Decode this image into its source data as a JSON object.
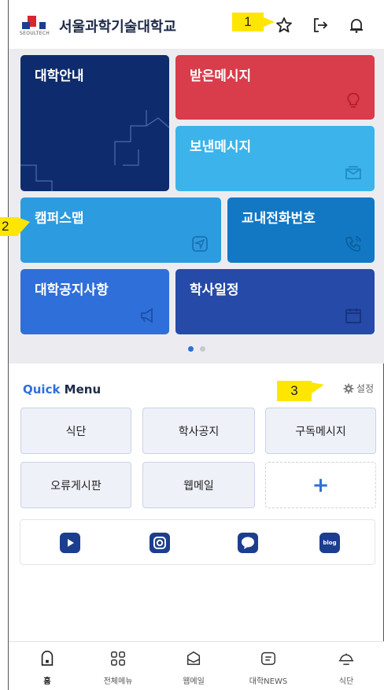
{
  "header": {
    "logo_text": "SEOULTECH",
    "university_name": "서울과학기술대학교",
    "icons": [
      "star-icon",
      "logout-icon",
      "bell-icon"
    ]
  },
  "markers": {
    "m1": "1",
    "m2": "2",
    "m3": "3"
  },
  "tiles": {
    "guide": "대학안내",
    "received": "받은메시지",
    "sent": "보낸메시지",
    "campus_map": "캠퍼스맵",
    "phone": "교내전화번호",
    "notice": "대학공지사항",
    "schedule": "학사일정"
  },
  "quick_menu": {
    "title_quick": "Quick",
    "title_menu": " Menu",
    "settings_label": "설정",
    "buttons": [
      "식단",
      "학사공지",
      "구독메시지",
      "오류게시판",
      "웹메일"
    ],
    "add_label": "+"
  },
  "social": [
    "youtube-icon",
    "instagram-icon",
    "chat-icon",
    "blog-icon"
  ],
  "social_blog_label": "blog",
  "bottom_nav": {
    "items": [
      {
        "label": "홈",
        "icon": "home-icon"
      },
      {
        "label": "전체메뉴",
        "icon": "grid-icon"
      },
      {
        "label": "웹메일",
        "icon": "mail-icon"
      },
      {
        "label": "대학NEWS",
        "icon": "news-icon"
      },
      {
        "label": "식단",
        "icon": "dish-icon"
      }
    ]
  },
  "colors": {
    "navy": "#0e2c6d",
    "red": "#d93c4a",
    "sky": "#3cb3ea",
    "azure": "#2d9be0",
    "steel": "#1278c4",
    "royal": "#2f6fd9",
    "indigo": "#254aa8",
    "accent": "#2f6fd9"
  }
}
